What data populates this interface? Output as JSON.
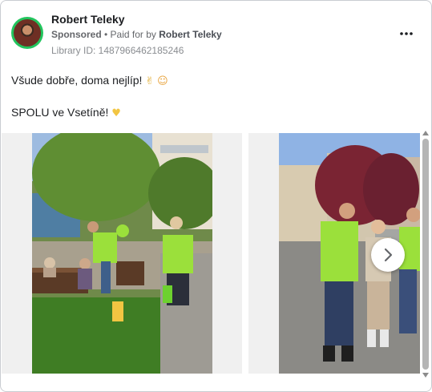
{
  "post": {
    "author": "Robert Teleky",
    "sponsored": "Sponsored",
    "paid_prefix": "• Paid for by",
    "paid_by": "Robert Teleky",
    "library_id": "Library ID: 1487966462185246",
    "line1_text": "Všude dobře, doma nejlíp!",
    "line1_emoji1": "✌",
    "line1_emoji2": "☺",
    "line2_text": "SPOLU ve Vsetíně!",
    "line2_emoji": "♥"
  },
  "carousel": {
    "slides": [
      {
        "name": "campaign-photo-park"
      },
      {
        "name": "campaign-photo-square"
      }
    ]
  },
  "icons": {
    "more": "more-horizontal-icon",
    "next": "chevron-right-icon"
  },
  "colors": {
    "avatar_ring": "#22c55e",
    "shirt_green": "#9be03b",
    "secondary_text": "#65676b"
  }
}
